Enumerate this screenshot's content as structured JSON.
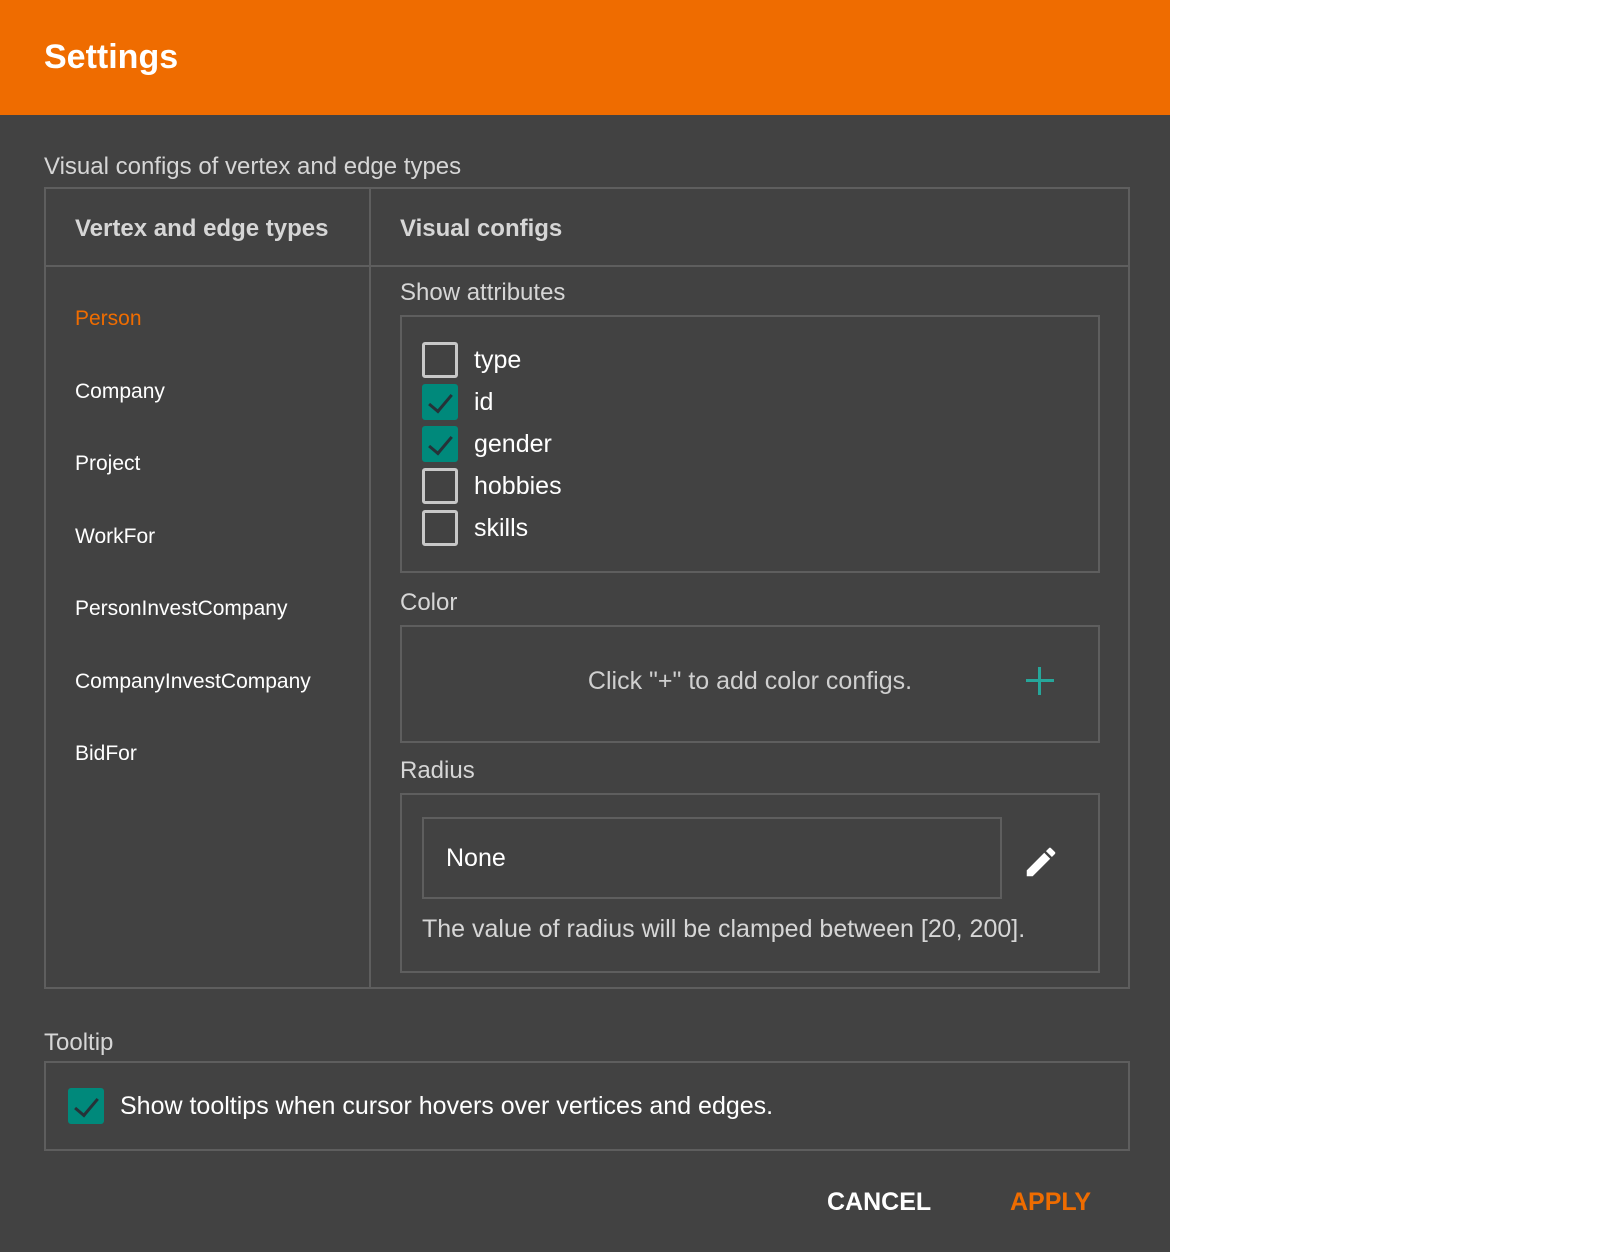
{
  "header": {
    "title": "Settings"
  },
  "visual_configs": {
    "section_label": "Visual configs of vertex and edge types",
    "table": {
      "col_types": "Vertex and edge types",
      "col_configs": "Visual configs"
    },
    "types": [
      {
        "label": "Person",
        "active": true
      },
      {
        "label": "Company",
        "active": false
      },
      {
        "label": "Project",
        "active": false
      },
      {
        "label": "WorkFor",
        "active": false
      },
      {
        "label": "PersonInvestCompany",
        "active": false
      },
      {
        "label": "CompanyInvestCompany",
        "active": false
      },
      {
        "label": "BidFor",
        "active": false
      }
    ],
    "show_attributes": {
      "label": "Show attributes",
      "items": [
        {
          "label": "type",
          "checked": false
        },
        {
          "label": "id",
          "checked": true
        },
        {
          "label": "gender",
          "checked": true
        },
        {
          "label": "hobbies",
          "checked": false
        },
        {
          "label": "skills",
          "checked": false
        }
      ]
    },
    "color": {
      "label": "Color",
      "hint": "Click \"+\" to add color configs.",
      "add_icon": "plus-icon"
    },
    "radius": {
      "label": "Radius",
      "value": "None",
      "edit_icon": "pencil-icon",
      "note": "The value of radius will be clamped between [20, 200]."
    }
  },
  "tooltip": {
    "section_label": "Tooltip",
    "option_label": "Show tooltips when cursor hovers over vertices and edges.",
    "checked": true
  },
  "actions": {
    "cancel_label": "CANCEL",
    "apply_label": "APPLY"
  },
  "colors": {
    "accent": "#ef6c00",
    "check": "#00897b",
    "panel": "#424242"
  }
}
